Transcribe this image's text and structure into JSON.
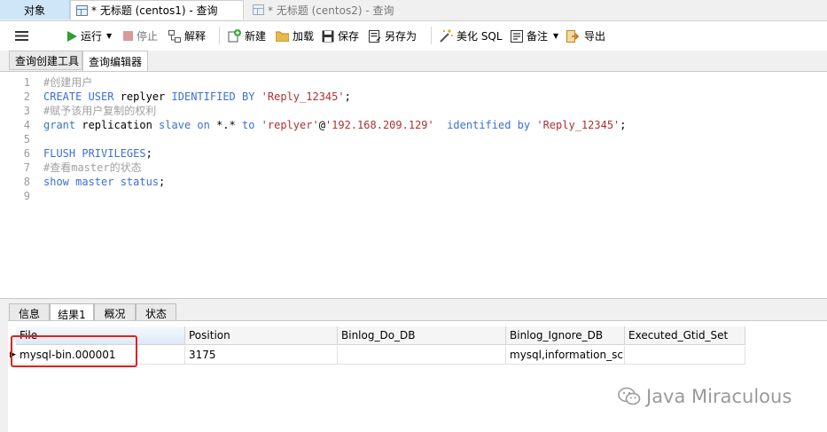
{
  "tabs": {
    "objects": "对象",
    "active_query": "* 无标题 (centos1) - 查询",
    "inactive_query": "* 无标题 (centos2) - 查询"
  },
  "toolbar": {
    "run": "运行",
    "stop": "停止",
    "explain": "解释",
    "new": "新建",
    "load": "加载",
    "save": "保存",
    "save_as": "另存为",
    "beautify": "美化 SQL",
    "comment": "备注",
    "export": "导出"
  },
  "subtabs": {
    "builder": "查询创建工具",
    "editor": "查询编辑器"
  },
  "editor": {
    "lines": [
      {
        "n": "1",
        "parts": [
          {
            "t": "#创建用户",
            "c": "cm"
          }
        ]
      },
      {
        "n": "2",
        "parts": [
          {
            "t": "CREATE USER",
            "c": "kw"
          },
          {
            "t": " replyer ",
            "c": "pl"
          },
          {
            "t": "IDENTIFIED BY",
            "c": "kw"
          },
          {
            "t": " ",
            "c": "pl"
          },
          {
            "t": "'Reply_12345'",
            "c": "str"
          },
          {
            "t": ";",
            "c": "pl"
          }
        ]
      },
      {
        "n": "3",
        "parts": [
          {
            "t": "#赋予该用户复制的权利",
            "c": "cm"
          }
        ]
      },
      {
        "n": "4",
        "parts": [
          {
            "t": "grant",
            "c": "kw"
          },
          {
            "t": " replication ",
            "c": "pl"
          },
          {
            "t": "slave on",
            "c": "kw"
          },
          {
            "t": " *.* ",
            "c": "pl"
          },
          {
            "t": "to",
            "c": "kw"
          },
          {
            "t": " ",
            "c": "pl"
          },
          {
            "t": "'replyer'",
            "c": "str"
          },
          {
            "t": "@",
            "c": "pl"
          },
          {
            "t": "'192.168.209.129'",
            "c": "str"
          },
          {
            "t": "  ",
            "c": "pl"
          },
          {
            "t": "identified by",
            "c": "kw"
          },
          {
            "t": " ",
            "c": "pl"
          },
          {
            "t": "'Reply_12345'",
            "c": "str"
          },
          {
            "t": ";",
            "c": "pl"
          }
        ]
      },
      {
        "n": "5",
        "parts": []
      },
      {
        "n": "6",
        "parts": [
          {
            "t": "FLUSH PRIVILEGES",
            "c": "kw"
          },
          {
            "t": ";",
            "c": "pl"
          }
        ]
      },
      {
        "n": "7",
        "parts": [
          {
            "t": "#查看master的状态",
            "c": "cm"
          }
        ]
      },
      {
        "n": "8",
        "parts": [
          {
            "t": "show master status",
            "c": "kw"
          },
          {
            "t": ";",
            "c": "pl"
          }
        ]
      },
      {
        "n": "9",
        "parts": []
      }
    ]
  },
  "result_tabs": [
    "信息",
    "结果1",
    "概况",
    "状态"
  ],
  "grid": {
    "columns": [
      "File",
      "Position",
      "Binlog_Do_DB",
      "Binlog_Ignore_DB",
      "Executed_Gtid_Set"
    ],
    "rows": [
      [
        "mysql-bin.000001",
        "3175",
        "",
        "mysql,information_schema",
        ""
      ]
    ]
  },
  "watermark": "Java Miraculous",
  "colors": {
    "keyword": "#3a6fd8",
    "string": "#b03030",
    "comment": "#a0a0a0",
    "highlight_box": "#e02020",
    "active_tab": "#cfe6f8"
  }
}
